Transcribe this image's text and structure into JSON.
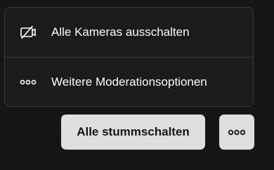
{
  "menu": {
    "items": [
      {
        "label": "Alle Kameras ausschalten",
        "icon": "camera-off-icon"
      },
      {
        "label": "Weitere Moderationsoptionen",
        "icon": "more-dots-icon"
      }
    ]
  },
  "actions": {
    "mute_all_label": "Alle stummschalten",
    "more_icon": "more-dots-icon"
  },
  "colors": {
    "background": "#161616",
    "menu_border": "#3a3a3a",
    "text": "#ffffff",
    "button_bg": "#dedede",
    "button_text": "#161616"
  }
}
